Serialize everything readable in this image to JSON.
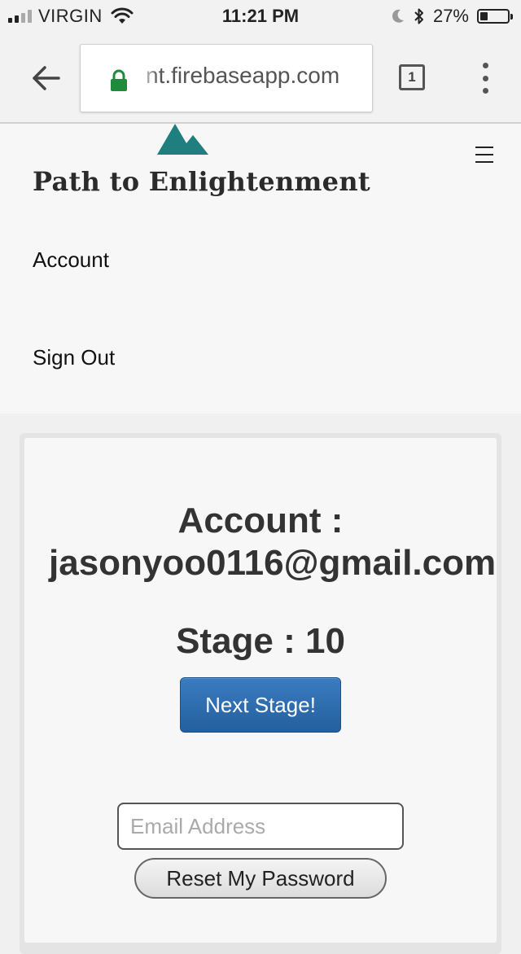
{
  "status_bar": {
    "carrier": "VIRGIN",
    "time": "11:21 PM",
    "battery_percent_text": "27%",
    "battery_level": 0.27
  },
  "browser": {
    "url": "nt.firebaseapp.com",
    "tab_count": "1"
  },
  "site": {
    "brand": "Path to Enlightenment",
    "logo_color": "#1f7f7f",
    "nav": {
      "account": "Account",
      "sign_out": "Sign Out"
    }
  },
  "account": {
    "title": "Account :",
    "email": "jasonyoo0116@gmail.com",
    "stage_text": "Stage : 10",
    "next_button": "Next Stage!",
    "email_placeholder": "Email Address",
    "reset_button": "Reset My Password"
  },
  "icons": {
    "back": "back-arrow-icon",
    "lock": "lock-icon",
    "wifi": "wifi-icon",
    "moon": "moon-icon",
    "bluetooth": "bluetooth-icon",
    "menu": "menu-dots-icon",
    "hamburger": "hamburger-icon"
  }
}
